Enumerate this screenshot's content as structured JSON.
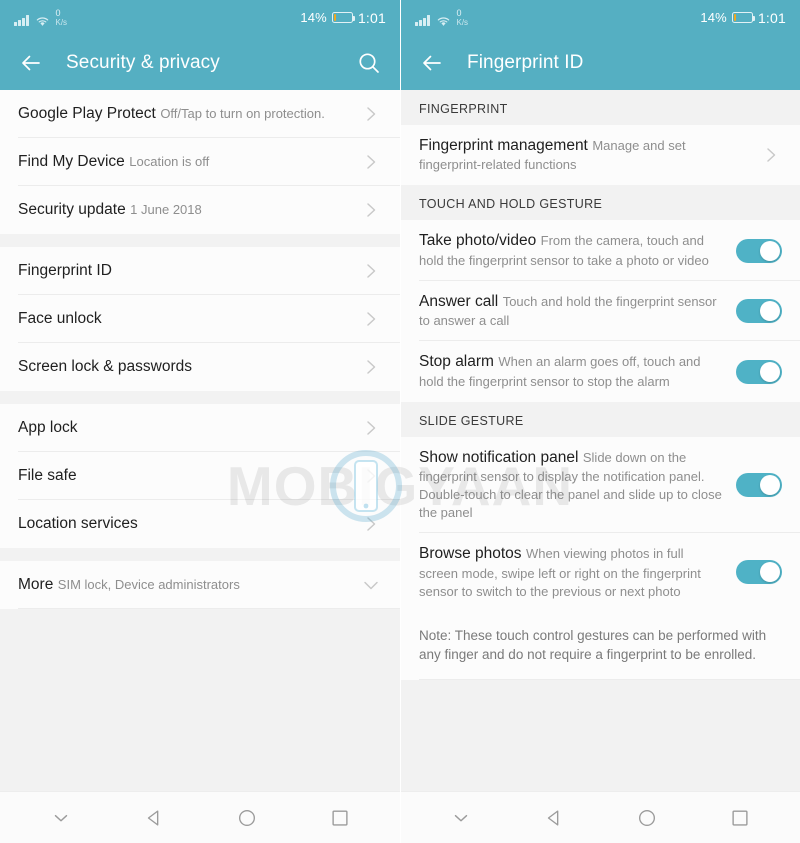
{
  "status_bar": {
    "network_speed_value": "0",
    "network_speed_unit": "K/s",
    "battery_percent_label": "14%",
    "battery_level": 14,
    "clock": "1:01",
    "signal_icon": "signal-bars-icon",
    "wifi_icon": "wifi-icon",
    "battery_icon": "battery-icon",
    "battery_fill_color": "#f0a81e"
  },
  "theme": {
    "accent": "#55afc2",
    "toggle_on": "#4fb2c6",
    "section_bg": "#f2f2f2",
    "row_bg": "#fcfcfc"
  },
  "left_screen": {
    "title": "Security & privacy",
    "back_icon": "back-arrow-icon",
    "search_icon": "search-icon",
    "groups": [
      {
        "rows": [
          {
            "title": "Google Play Protect",
            "sub": "Off/Tap to turn on protection.",
            "accessory": "chevron-right-icon"
          },
          {
            "title": "Find My Device",
            "sub": "Location is off",
            "accessory": "chevron-right-icon"
          },
          {
            "title": "Security update",
            "sub": "1 June 2018",
            "accessory": "chevron-right-icon"
          }
        ]
      },
      {
        "rows": [
          {
            "title": "Fingerprint ID",
            "sub": "",
            "accessory": "chevron-right-icon"
          },
          {
            "title": "Face unlock",
            "sub": "",
            "accessory": "chevron-right-icon"
          },
          {
            "title": "Screen lock & passwords",
            "sub": "",
            "accessory": "chevron-right-icon"
          }
        ]
      },
      {
        "rows": [
          {
            "title": "App lock",
            "sub": "",
            "accessory": "chevron-right-icon"
          },
          {
            "title": "File safe",
            "sub": "",
            "accessory": "chevron-right-icon"
          },
          {
            "title": "Location services",
            "sub": "",
            "accessory": "chevron-right-icon"
          }
        ]
      },
      {
        "rows": [
          {
            "title": "More",
            "sub": "SIM lock, Device administrators",
            "accessory": "chevron-down-icon"
          }
        ]
      }
    ]
  },
  "right_screen": {
    "title": "Fingerprint ID",
    "back_icon": "back-arrow-icon",
    "sections": [
      {
        "header": "FINGERPRINT",
        "rows": [
          {
            "title": "Fingerprint management",
            "sub": "Manage and set fingerprint-related functions",
            "accessory": "chevron-right-icon"
          }
        ]
      },
      {
        "header": "TOUCH AND HOLD GESTURE",
        "rows": [
          {
            "title": "Take photo/video",
            "sub": "From the camera, touch and hold the fingerprint sensor to take a photo or video",
            "accessory": "toggle",
            "toggle_on": true
          },
          {
            "title": "Answer call",
            "sub": "Touch and hold the fingerprint sensor to answer a call",
            "accessory": "toggle",
            "toggle_on": true
          },
          {
            "title": "Stop alarm",
            "sub": "When an alarm goes off, touch and hold the fingerprint sensor to stop the alarm",
            "accessory": "toggle",
            "toggle_on": true
          }
        ]
      },
      {
        "header": "SLIDE GESTURE",
        "rows": [
          {
            "title": "Show notification panel",
            "sub": "Slide down on the fingerprint sensor to display the notification panel. Double-touch to clear the panel and slide up to close the panel",
            "accessory": "toggle",
            "toggle_on": true
          },
          {
            "title": "Browse photos",
            "sub": "When viewing photos in full screen mode, swipe left or right on the fingerprint sensor to switch to the previous or next photo",
            "accessory": "toggle",
            "toggle_on": true
          }
        ],
        "note": "Note: These touch control gestures can be performed with any finger and do not require a fingerprint to be enrolled."
      }
    ]
  },
  "nav_bar": {
    "buttons": [
      {
        "icon": "chevron-down-icon",
        "name": "hide-navbar-button"
      },
      {
        "icon": "back-triangle-icon",
        "name": "back-button"
      },
      {
        "icon": "home-circle-icon",
        "name": "home-button"
      },
      {
        "icon": "recents-square-icon",
        "name": "recents-button"
      }
    ]
  },
  "watermark": {
    "text": "MOBIGYAAN",
    "logo_icon": "mobigyaan-phone-logo-icon"
  }
}
